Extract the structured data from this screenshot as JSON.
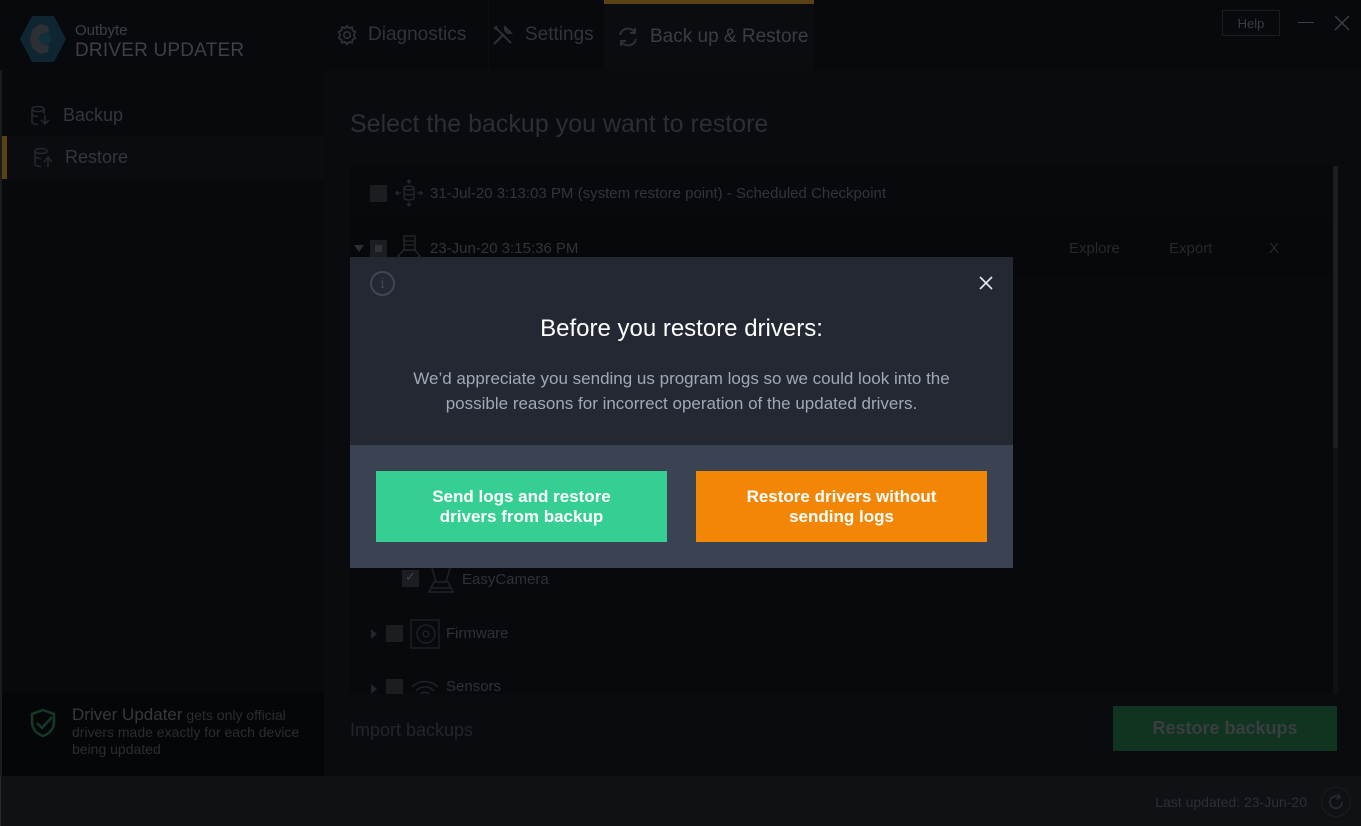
{
  "app": {
    "brand_top": "Outbyte",
    "brand_bottom": "DRIVER UPDATER"
  },
  "tabs": [
    {
      "label": "Diagnostics",
      "icon": "gear-icon",
      "active": false
    },
    {
      "label": "Settings",
      "icon": "tools-icon",
      "active": false
    },
    {
      "label": "Back up & Restore",
      "icon": "sync-icon",
      "active": true
    }
  ],
  "window": {
    "help_label": "Help"
  },
  "sidebar": {
    "items": [
      {
        "label": "Backup",
        "icon": "database-download-icon",
        "active": false
      },
      {
        "label": "Restore",
        "icon": "database-upload-icon",
        "active": true
      }
    ],
    "footer": {
      "highlight": "Driver Updater",
      "text": " gets only official drivers made exactly for each device being updated"
    }
  },
  "main": {
    "title": "Select the backup you want to restore",
    "backups": [
      {
        "label": "31-Jul-20 3:13:03 PM (system restore point) - Scheduled Checkpoint",
        "checked": false
      },
      {
        "label": "23-Jun-20 3:15:36 PM",
        "checked": "partial",
        "expanded": true,
        "actions": [
          "Explore",
          "Export",
          "X"
        ]
      }
    ],
    "tree_items": [
      {
        "label": "EasyCamera",
        "checked": true
      },
      {
        "label": "Firmware",
        "checked": false,
        "expandable": true
      },
      {
        "label": "Sensors",
        "checked": false,
        "expandable": true
      }
    ],
    "import_label": "Import backups",
    "restore_label": "Restore backups"
  },
  "status": {
    "last_updated": "Last updated: 23-Jun-20"
  },
  "modal": {
    "title": "Before you restore drivers:",
    "text": "We’d appreciate you sending us program logs so we could look into the possible reasons for incorrect operation of the updated drivers.",
    "send_button": "Send logs and restore drivers from backup",
    "nosend_button": "Restore drivers without sending logs"
  },
  "colors": {
    "accent": "#5a4214",
    "send_button": "#35cf93",
    "nosend_button": "#f48605",
    "modal_bg": "#232833",
    "modal_footer_bg": "#3a4352"
  }
}
